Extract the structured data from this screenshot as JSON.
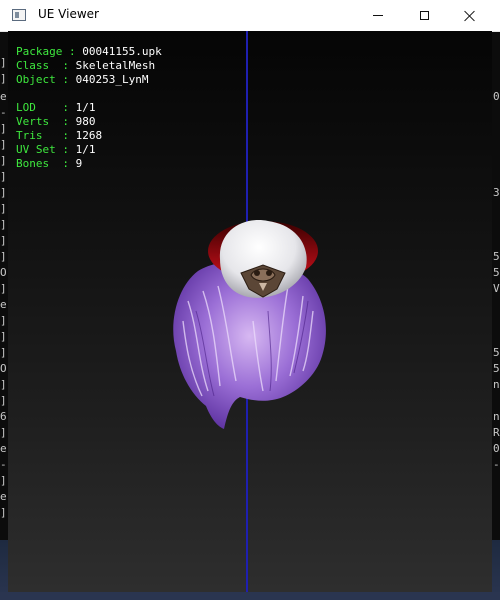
{
  "window": {
    "title": "UE Viewer",
    "icon": "app-window-icon"
  },
  "viewport": {
    "info": {
      "package": {
        "label": "Package",
        "value": "00041155.upk"
      },
      "class": {
        "label": "Class  ",
        "value": "SkeletalMesh"
      },
      "object": {
        "label": "Object ",
        "value": "040253_LynM"
      },
      "lod": {
        "label": "LOD    ",
        "value": "1/1"
      },
      "verts": {
        "label": "Verts  ",
        "value": "980"
      },
      "tris": {
        "label": "Tris   ",
        "value": "1268"
      },
      "uvset": {
        "label": "UV Set ",
        "value": "1/1"
      },
      "bones": {
        "label": "Bones  ",
        "value": "9"
      }
    }
  },
  "background_console": {
    "left_chars": [
      "]",
      "]",
      "e",
      "-",
      "]",
      "]",
      "]",
      "]",
      "]",
      "]",
      "]",
      "]",
      "]",
      "O",
      "]",
      "e",
      "]",
      "]",
      "]",
      "O",
      "]",
      "]",
      "6",
      "]",
      "e",
      "-",
      "]",
      "e",
      "]"
    ],
    "right_chars": [
      "0",
      "",
      "",
      "",
      "",
      "3",
      "",
      "",
      "",
      "5",
      "5",
      "V",
      "",
      "",
      "",
      "5",
      "5",
      "n",
      "",
      "n",
      "R",
      "0",
      "-"
    ]
  },
  "colors": {
    "info_key": "#3ee83e",
    "info_value": "#ffffff",
    "axis": "#1f1fb0",
    "hair": "#9b6fd6",
    "cap_rim": "#c0101a"
  }
}
